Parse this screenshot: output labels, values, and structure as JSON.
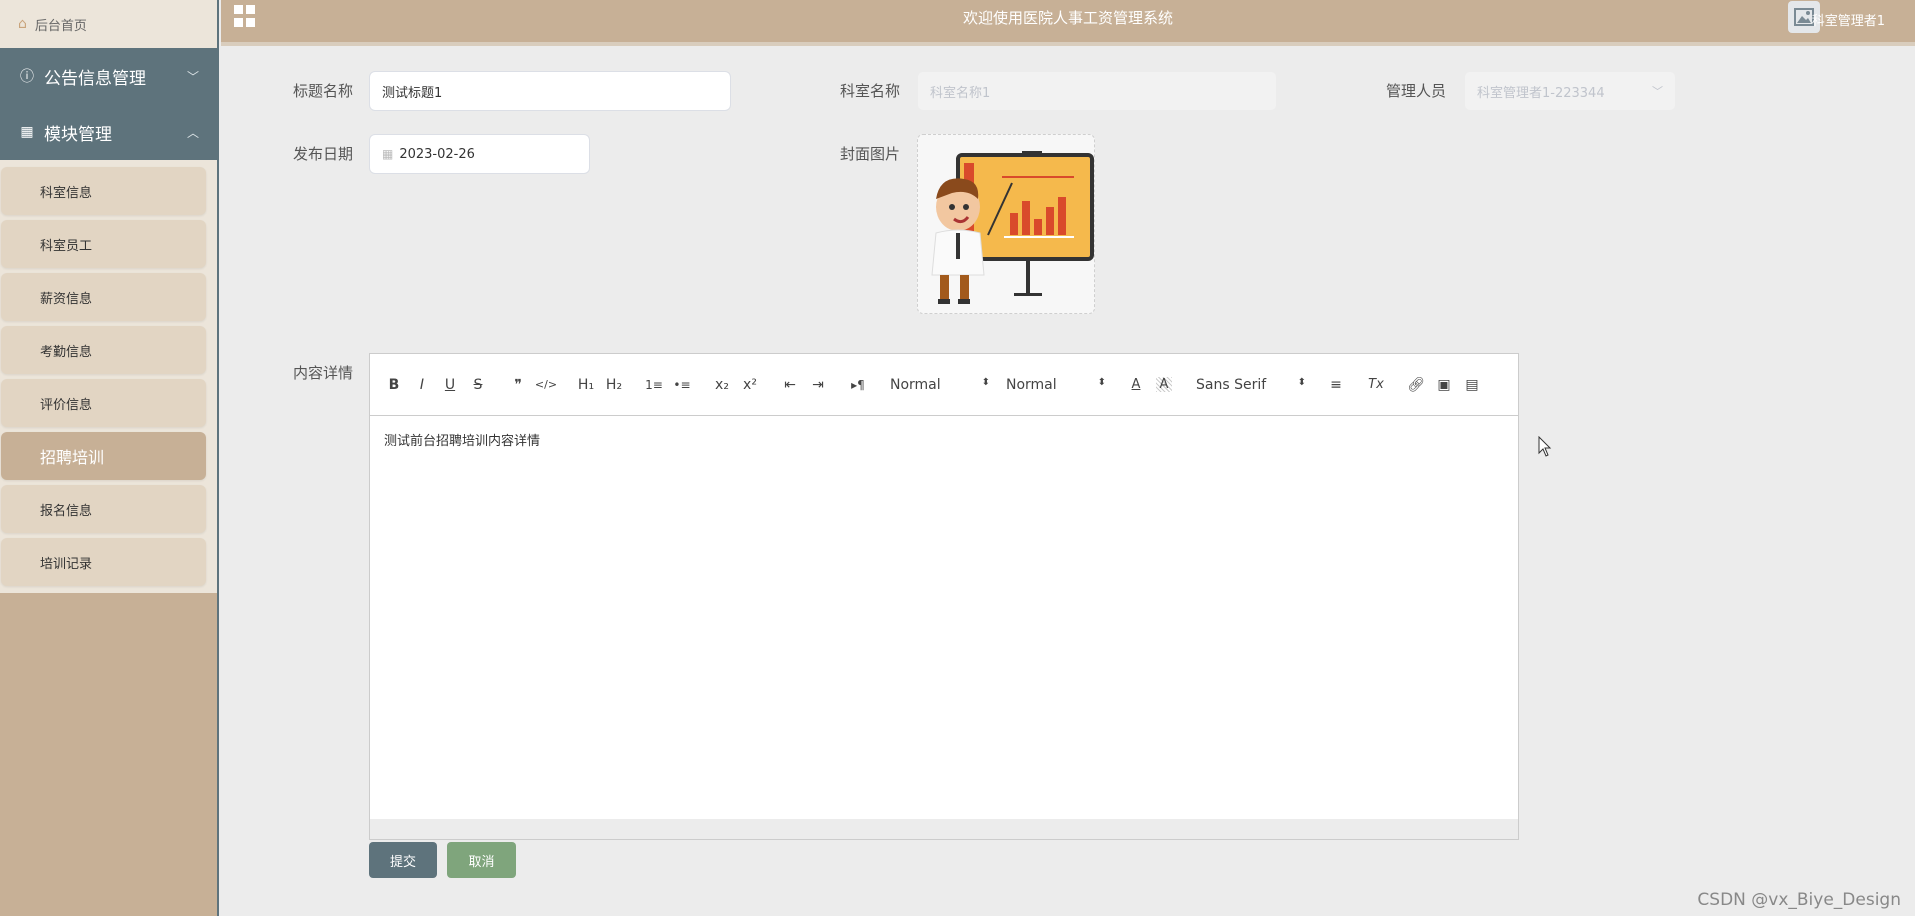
{
  "colors": {
    "sidebar_dark": "#5e737c",
    "brand_tan": "#c7b096",
    "cancel_green": "#7fa57c"
  },
  "sidebar": {
    "home": {
      "label": "后台首页",
      "icon": "home-icon"
    },
    "groups": [
      {
        "label": "公告信息管理",
        "icon": "info-circle-icon",
        "expanded": false
      },
      {
        "label": "模块管理",
        "icon": "grid-icon",
        "expanded": true
      }
    ],
    "items": [
      {
        "label": "科室信息"
      },
      {
        "label": "科室员工"
      },
      {
        "label": "薪资信息"
      },
      {
        "label": "考勤信息"
      },
      {
        "label": "评价信息"
      },
      {
        "label": "招聘培训",
        "active": true
      },
      {
        "label": "报名信息"
      },
      {
        "label": "培训记录"
      }
    ]
  },
  "header": {
    "title": "欢迎使用医院人事工资管理系统",
    "user": "科室管理者1",
    "menu_icon": "grid-menu-icon",
    "avatar_icon": "image-icon"
  },
  "form": {
    "title": {
      "label": "标题名称",
      "value": "测试标题1"
    },
    "dept": {
      "label": "科室名称",
      "placeholder": "科室名称1"
    },
    "manager": {
      "label": "管理人员",
      "value": "科室管理者1-223344"
    },
    "date": {
      "label": "发布日期",
      "value": "2023-02-26"
    },
    "cover": {
      "label": "封面图片",
      "alt": "presenter-illustration"
    },
    "content": {
      "label": "内容详情",
      "text": "测试前台招聘培训内容详情",
      "toolbar": {
        "bold": "B",
        "italic": "I",
        "underline": "U",
        "strike": "S",
        "quote": "❞",
        "code": "</>",
        "h1": "H₁",
        "h2": "H₂",
        "ol": "1≡",
        "ul": "•≡",
        "sub": "x₂",
        "sup": "x²",
        "outdent": "⇤",
        "indent": "⇥",
        "direction": "▸¶",
        "size": "Normal",
        "header": "Normal",
        "font": "Sans Serif",
        "align": "≡",
        "clean": "Tx"
      }
    }
  },
  "actions": {
    "submit": "提交",
    "cancel": "取消"
  },
  "watermark": "CSDN @vx_Biye_Design"
}
